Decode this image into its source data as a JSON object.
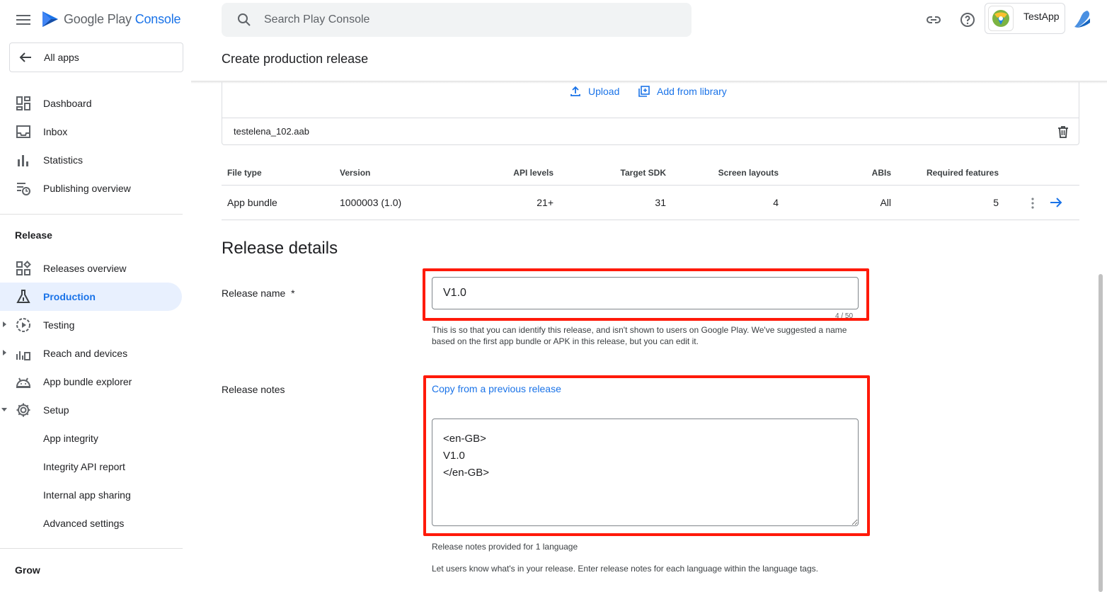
{
  "header": {
    "logo_google_play": "Google Play",
    "logo_console": "Console",
    "search_placeholder": "Search Play Console",
    "app_name": "TestApp"
  },
  "sidebar": {
    "all_apps": "All apps",
    "top_items": [
      {
        "label": "Dashboard",
        "icon": "dashboard-icon"
      },
      {
        "label": "Inbox",
        "icon": "inbox-icon"
      },
      {
        "label": "Statistics",
        "icon": "bar-chart-icon"
      },
      {
        "label": "Publishing overview",
        "icon": "publishing-overview-icon"
      }
    ],
    "release_section": "Release",
    "release_items": [
      {
        "label": "Releases overview",
        "icon": "releases-overview-icon"
      },
      {
        "label": "Production",
        "icon": "production-flask-icon",
        "active": true
      },
      {
        "label": "Testing",
        "icon": "testing-play-icon"
      },
      {
        "label": "Reach and devices",
        "icon": "reach-devices-icon"
      },
      {
        "label": "App bundle explorer",
        "icon": "android-icon"
      },
      {
        "label": "Setup",
        "icon": "gear-icon"
      },
      {
        "label": "App integrity"
      },
      {
        "label": "Integrity API report"
      },
      {
        "label": "Internal app sharing"
      },
      {
        "label": "Advanced settings"
      }
    ],
    "grow_section": "Grow"
  },
  "main": {
    "page_title": "Create production release",
    "upload_label": "Upload",
    "add_from_library_label": "Add from library",
    "file_name": "testelena_102.aab",
    "table": {
      "headers": [
        "File type",
        "Version",
        "API levels",
        "Target SDK",
        "Screen layouts",
        "ABIs",
        "Required features"
      ],
      "row": [
        "App bundle",
        "1000003 (1.0)",
        "21+",
        "31",
        "4",
        "All",
        "5"
      ]
    },
    "release_details_title": "Release details",
    "release_name_label": "Release name",
    "release_name_required": "*",
    "release_name_value": "V1.0",
    "release_name_counter": "4 / 50",
    "release_name_hint": "This is so that you can identify this release, and isn't shown to users on Google Play. We've suggested a name based on the first app bundle or APK in this release, but you can edit it.",
    "release_notes_label": "Release notes",
    "copy_previous": "Copy from a previous release",
    "release_notes_value": "<en-GB>\nV1.0\n</en-GB>",
    "notes_language_hint": "Release notes provided for 1 language",
    "notes_help": "Let users know what's in your release. Enter release notes for each language within the language tags."
  },
  "colors": {
    "accent": "#1a73e8",
    "highlight": "#ff1a0a",
    "active_bg": "#e8f0fe"
  }
}
